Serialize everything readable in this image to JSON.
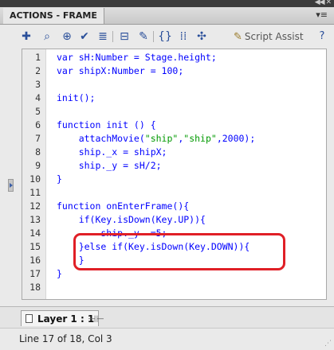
{
  "panel": {
    "title": "ACTIONS - FRAME",
    "menu_icon": "panel-menu-icon",
    "collapse_icon": "double-arrow-icon"
  },
  "toolbar": {
    "icons": [
      "add-statement-icon",
      "find-icon",
      "target-icon",
      "check-syntax-icon",
      "auto-format-icon",
      "code-hint-icon",
      "debug-options-icon",
      "collapse-braces-icon",
      "collapse-selection-icon",
      "expand-all-icon",
      "help-icon"
    ],
    "script_assist": "Script Assist"
  },
  "code": {
    "lines": [
      "var sH:Number = Stage.height;",
      "var shipX:Number = 100;",
      "",
      "init();",
      "",
      "function init () {",
      "    attachMovie(\"ship\",\"ship\",2000);",
      "    ship._x = shipX;",
      "    ship._y = sH/2;",
      "}",
      "",
      "function onEnterFrame(){",
      "    if(Key.isDown(Key.UP)){",
      "        ship._y -=5;",
      "    }else if(Key.isDown(Key.DOWN)){",
      "    }",
      "}",
      ""
    ]
  },
  "layer": {
    "label": "Layer 1 : 1"
  },
  "status": {
    "text": "Line 17 of 18, Col 3"
  }
}
